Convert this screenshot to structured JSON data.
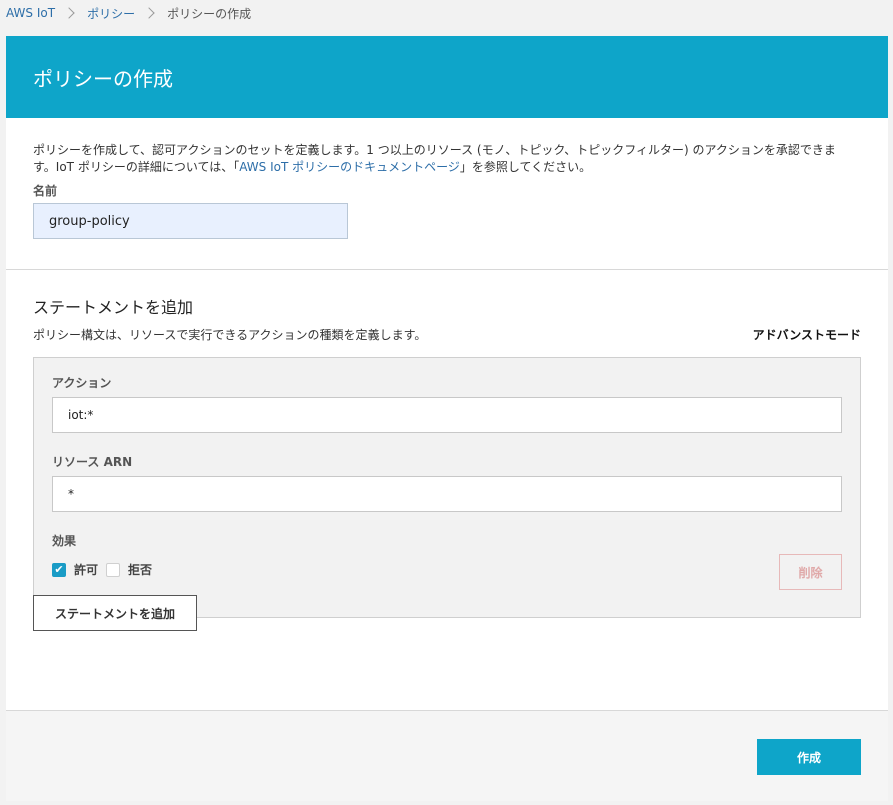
{
  "breadcrumb": {
    "items": [
      "AWS IoT",
      "ポリシー"
    ],
    "current": "ポリシーの作成"
  },
  "header": {
    "title": "ポリシーの作成"
  },
  "intro": {
    "text_before_link": "ポリシーを作成して、認可アクションのセットを定義します。1 つ以上のリソース (モノ、トピック、トピックフィルター) のアクションを承認できます。IoT ポリシーの詳細については、「",
    "link_text": "AWS IoT ポリシーのドキュメントページ",
    "text_after_link": "」を参照してください。"
  },
  "name": {
    "label": "名前",
    "value": "group-policy"
  },
  "statements": {
    "title": "ステートメントを追加",
    "description": "ポリシー構文は、リソースで実行できるアクションの種類を定義します。",
    "advanced_mode": "アドバンストモード",
    "statement": {
      "action_label": "アクション",
      "action_value": "iot:*",
      "resource_label": "リソース ARN",
      "resource_value": "*",
      "effect_label": "効果",
      "allow_label": "許可",
      "deny_label": "拒否",
      "delete_label": "削除"
    },
    "add_button": "ステートメントを追加"
  },
  "footer": {
    "create_button": "作成"
  },
  "colors": {
    "accent": "#0ea5c9",
    "link": "#2d6ea8",
    "checkbox": "#1a9cc6"
  }
}
